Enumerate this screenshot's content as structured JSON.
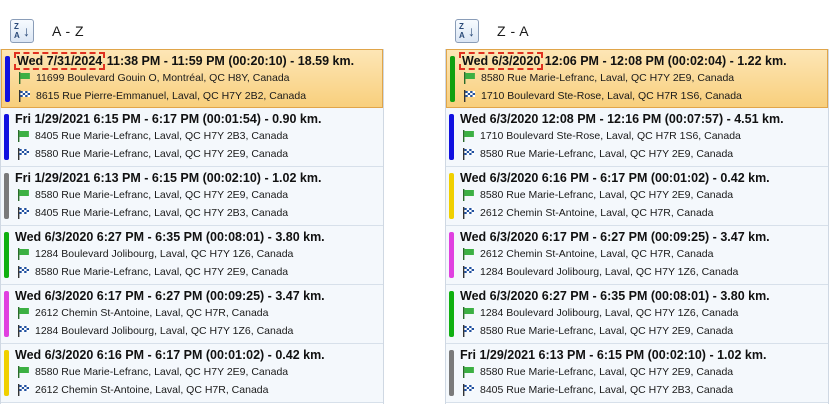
{
  "panels": [
    {
      "sort_label": "A - Z",
      "sort_icon": "sort-ascending-icon",
      "trips": [
        {
          "date": "Wed 7/31/2024",
          "rest": "11:38 PM - 11:59 PM  (00:20:10) - 18.59 km.",
          "start": "11699 Boulevard Gouin O, Montréal, QC H8Y, Canada",
          "end": "8615 Rue Pierre-Emmanuel, Laval, QC H7Y 2B2, Canada",
          "color": "#1010e0",
          "selected": true
        },
        {
          "date": "Fri 1/29/2021",
          "rest": "6:15 PM - 6:17 PM  (00:01:54) - 0.90 km.",
          "start": "8405 Rue Marie-Lefranc, Laval, QC H7Y 2B3, Canada",
          "end": "8580 Rue Marie-Lefranc, Laval, QC H7Y 2E9, Canada",
          "color": "#1010e0",
          "selected": false
        },
        {
          "date": "Fri 1/29/2021",
          "rest": "6:13 PM - 6:15 PM  (00:02:10) - 1.02 km.",
          "start": "8580 Rue Marie-Lefranc, Laval, QC H7Y 2E9, Canada",
          "end": "8405 Rue Marie-Lefranc, Laval, QC H7Y 2B3, Canada",
          "color": "#7a7a7a",
          "selected": false
        },
        {
          "date": "Wed 6/3/2020",
          "rest": "6:27 PM - 6:35 PM  (00:08:01) - 3.80 km.",
          "start": "1284 Boulevard Jolibourg, Laval, QC H7Y 1Z6, Canada",
          "end": "8580 Rue Marie-Lefranc, Laval, QC H7Y 2E9, Canada",
          "color": "#10b010",
          "selected": false
        },
        {
          "date": "Wed 6/3/2020",
          "rest": "6:17 PM - 6:27 PM  (00:09:25) - 3.47 km.",
          "start": "2612 Chemin St-Antoine, Laval, QC H7R, Canada",
          "end": "1284 Boulevard Jolibourg, Laval, QC H7Y 1Z6, Canada",
          "color": "#e040e0",
          "selected": false
        },
        {
          "date": "Wed 6/3/2020",
          "rest": "6:16 PM - 6:17 PM  (00:01:02) - 0.42 km.",
          "start": "8580 Rue Marie-Lefranc, Laval, QC H7Y 2E9, Canada",
          "end": "2612 Chemin St-Antoine, Laval, QC H7R, Canada",
          "color": "#f0d000",
          "selected": false
        }
      ]
    },
    {
      "sort_label": "Z - A",
      "sort_icon": "sort-descending-icon",
      "trips": [
        {
          "date": "Wed 6/3/2020",
          "rest": "12:06 PM - 12:08 PM  (00:02:04) - 1.22 km.",
          "start": "8580 Rue Marie-Lefranc, Laval, QC H7Y 2E9, Canada",
          "end": "1710 Boulevard Ste-Rose, Laval, QC H7R 1S6, Canada",
          "color": "#10a010",
          "selected": true
        },
        {
          "date": "Wed 6/3/2020",
          "rest": "12:08 PM - 12:16 PM  (00:07:57) - 4.51 km.",
          "start": "1710 Boulevard Ste-Rose, Laval, QC H7R 1S6, Canada",
          "end": "8580 Rue Marie-Lefranc, Laval, QC H7Y 2E9, Canada",
          "color": "#1010e0",
          "selected": false
        },
        {
          "date": "Wed 6/3/2020",
          "rest": "6:16 PM - 6:17 PM  (00:01:02) - 0.42 km.",
          "start": "8580 Rue Marie-Lefranc, Laval, QC H7Y 2E9, Canada",
          "end": "2612 Chemin St-Antoine, Laval, QC H7R, Canada",
          "color": "#f0d000",
          "selected": false
        },
        {
          "date": "Wed 6/3/2020",
          "rest": "6:17 PM - 6:27 PM  (00:09:25) - 3.47 km.",
          "start": "2612 Chemin St-Antoine, Laval, QC H7R, Canada",
          "end": "1284 Boulevard Jolibourg, Laval, QC H7Y 1Z6, Canada",
          "color": "#e040e0",
          "selected": false
        },
        {
          "date": "Wed 6/3/2020",
          "rest": "6:27 PM - 6:35 PM  (00:08:01) - 3.80 km.",
          "start": "1284 Boulevard Jolibourg, Laval, QC H7Y 1Z6, Canada",
          "end": "8580 Rue Marie-Lefranc, Laval, QC H7Y 2E9, Canada",
          "color": "#10b010",
          "selected": false
        },
        {
          "date": "Fri 1/29/2021",
          "rest": "6:13 PM - 6:15 PM  (00:02:10) - 1.02 km.",
          "start": "8580 Rue Marie-Lefranc, Laval, QC H7Y 2E9, Canada",
          "end": "8405 Rue Marie-Lefranc, Laval, QC H7Y 2B3, Canada",
          "color": "#7a7a7a",
          "selected": false
        }
      ]
    }
  ]
}
